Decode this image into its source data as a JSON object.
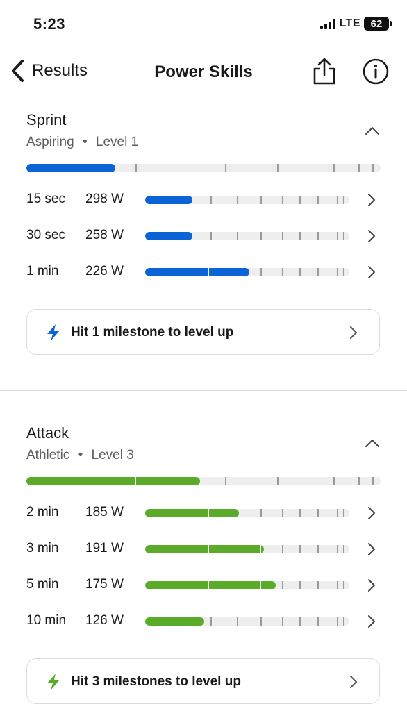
{
  "status": {
    "time": "5:23",
    "network": "LTE",
    "battery": "62"
  },
  "nav": {
    "back_label": "Results",
    "title": "Power Skills"
  },
  "colors": {
    "sprint_accent": "#0a64d6",
    "attack_accent": "#5bab2a",
    "track": "#eeeeee"
  },
  "sections": [
    {
      "title": "Sprint",
      "tier": "Aspiring",
      "separator": "•",
      "level": "Level 1",
      "overall_progress": 0.25,
      "rows": [
        {
          "duration": "15 sec",
          "watts": "298 W",
          "progress": 0.23
        },
        {
          "duration": "30 sec",
          "watts": "258 W",
          "progress": 0.23
        },
        {
          "duration": "1 min",
          "watts": "226 W",
          "progress": 0.51
        }
      ],
      "milestone": "Hit 1 milestone to level up"
    },
    {
      "title": "Attack",
      "tier": "Athletic",
      "separator": "•",
      "level": "Level 3",
      "overall_progress": 0.49,
      "rows": [
        {
          "duration": "2 min",
          "watts": "185 W",
          "progress": 0.46
        },
        {
          "duration": "3 min",
          "watts": "191 W",
          "progress": 0.58
        },
        {
          "duration": "5 min",
          "watts": "175 W",
          "progress": 0.64
        },
        {
          "duration": "10 min",
          "watts": "126 W",
          "progress": 0.29
        }
      ],
      "milestone": "Hit 3 milestones to level up"
    }
  ]
}
